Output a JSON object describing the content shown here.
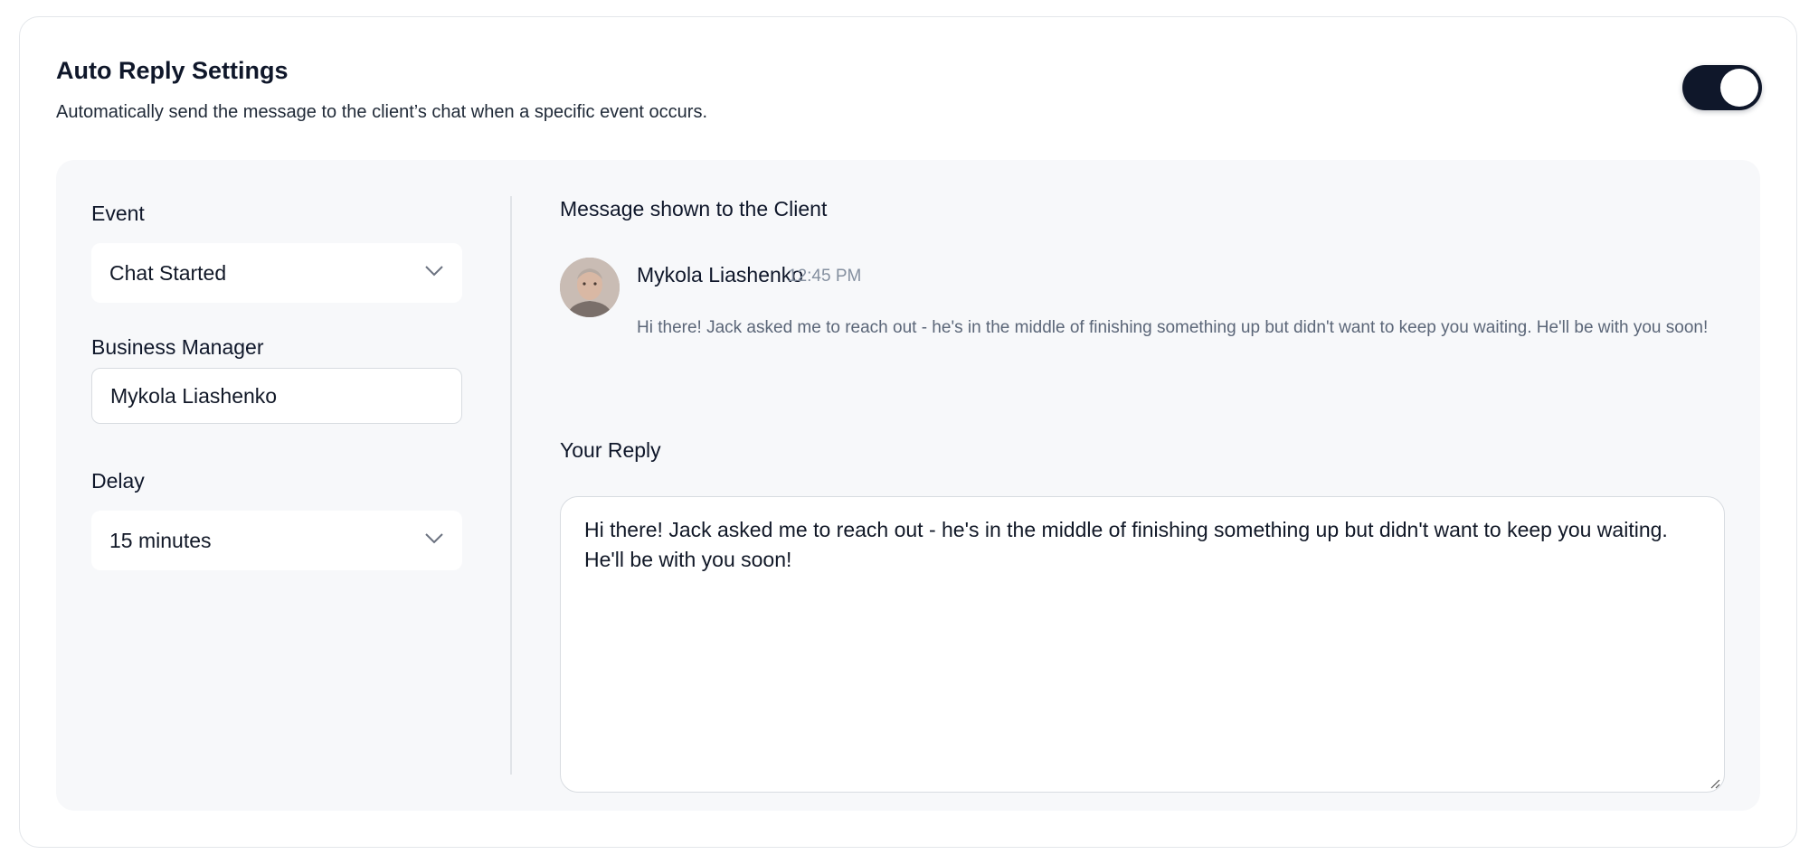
{
  "header": {
    "title": "Auto Reply Settings",
    "subtitle": "Automatically send the message to the client’s chat when a specific event occurs.",
    "toggle_on": true
  },
  "form": {
    "event_label": "Event",
    "event_value": "Chat Started",
    "manager_label": "Business Manager",
    "manager_value": "Mykola Liashenko",
    "delay_label": "Delay",
    "delay_value": "15 minutes"
  },
  "preview": {
    "heading": "Message shown to the Client",
    "sender": "Mykola Liashenko",
    "time": "12:45 PM",
    "message": "Hi there! Jack asked me to reach out - he's in the middle of finishing something up but didn't want to keep you waiting. He'll be with you soon!"
  },
  "reply": {
    "label": "Your Reply",
    "value": "Hi there! Jack asked me to reach out - he's in the middle of finishing something up but didn't want to keep you waiting. He'll be with you soon!"
  },
  "colors": {
    "accent": "#0f172a",
    "panel_bg": "#f7f8fa",
    "muted_text": "#5b6678"
  },
  "icons": {
    "dropdown": "chevron-down-icon",
    "resize": "resize-grip-icon"
  }
}
